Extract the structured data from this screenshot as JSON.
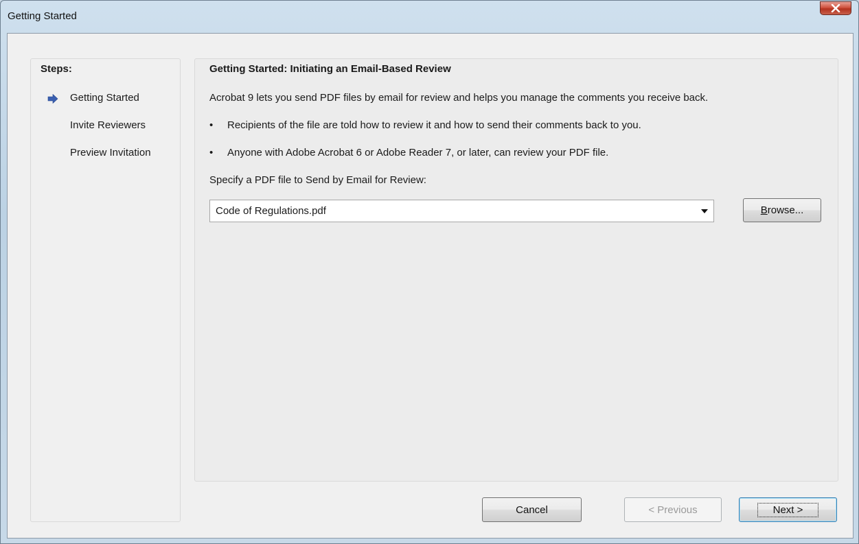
{
  "window": {
    "title": "Getting Started",
    "close_label": "X"
  },
  "steps": {
    "heading": "Steps:",
    "items": [
      {
        "label": "Getting Started",
        "current": true
      },
      {
        "label": "Invite Reviewers",
        "current": false
      },
      {
        "label": "Preview Invitation",
        "current": false
      }
    ]
  },
  "main": {
    "title": "Getting Started: Initiating an Email-Based Review",
    "intro": "Acrobat 9 lets you send PDF files by email for review and helps you manage the comments you receive back.",
    "bullet_char": "•",
    "bullets": [
      "Recipients of the file are told how to review it and how to send their comments back to you.",
      "Anyone with Adobe Acrobat 6 or Adobe Reader 7, or later, can review your PDF file."
    ],
    "specify_label": "Specify a PDF file to Send by Email for Review:",
    "file_value": "Code of Regulations.pdf",
    "browse_mnemonic": "B",
    "browse_rest": "rowse..."
  },
  "footer": {
    "cancel_label": "Cancel",
    "previous_label": "< Previous",
    "next_label": "Next >"
  },
  "icons": {
    "step_arrow": "arrow-right-icon",
    "dropdown": "chevron-down-icon",
    "close": "close-icon"
  },
  "colors": {
    "arrow": "#3a5fb0",
    "close_button": "#c9482f"
  }
}
